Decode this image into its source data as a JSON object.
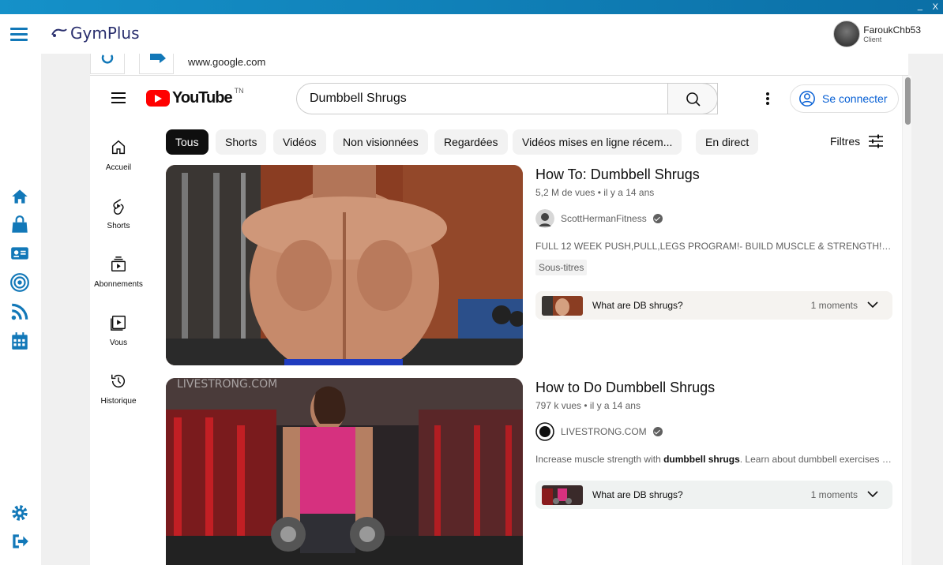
{
  "window": {
    "minimize": "_",
    "close": "X"
  },
  "app": {
    "name": "GymPlus",
    "user": {
      "name": "FaroukChb53",
      "role": "Client"
    }
  },
  "browser": {
    "url": "www.google.com"
  },
  "yt": {
    "logo": "YouTube",
    "country": "TN",
    "search_value": "Dumbbell Shrugs",
    "signin": "Se connecter",
    "sidebar": [
      "Accueil",
      "Shorts",
      "Abonnements",
      "Vous",
      "Historique"
    ],
    "chips": [
      "Tous",
      "Shorts",
      "Vidéos",
      "Non visionnées",
      "Regardées",
      "Vidéos mises en ligne récem...",
      "En direct"
    ],
    "filters": "Filtres",
    "videos": [
      {
        "title": "How To: Dumbbell Shrugs",
        "meta": "5,2 M de vues • il y a 14 ans",
        "channel": "ScottHermanFitness",
        "desc": "FULL 12 WEEK PUSH,PULL,LEGS PROGRAM!- BUILD MUSCLE & STRENGTH! - http:/...",
        "badge": "Sous-titres",
        "moment": "What are DB shrugs?",
        "moments": "1 moments"
      },
      {
        "title": "How to Do Dumbbell Shrugs",
        "meta": "797 k vues • il y a 14 ans",
        "channel": "LIVESTRONG.COM",
        "desc_pre": "Increase muscle strength with ",
        "desc_bold": "dumbbell shrugs",
        "desc_post": ". Learn about dumbbell exercises in...",
        "moment": "What are DB shrugs?",
        "moments": "1 moments",
        "watermark": "LIVESTRONG.COM"
      }
    ]
  },
  "colors": {
    "accent": "#1278b8",
    "youtube_red": "#ff0000",
    "link_blue": "#065fd4"
  }
}
